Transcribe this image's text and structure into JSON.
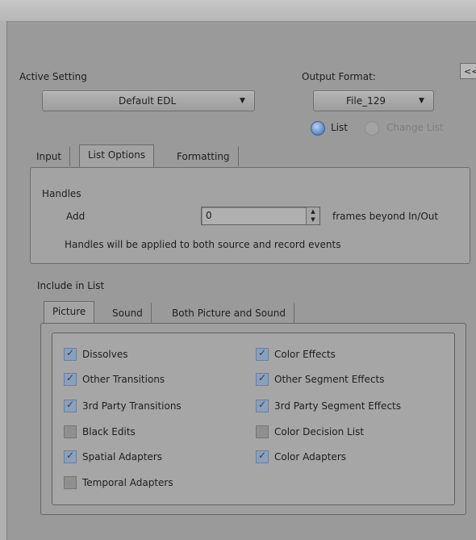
{
  "collapse_button": "<<",
  "active_setting": {
    "label": "Active Setting",
    "value": "Default EDL"
  },
  "output_format": {
    "label": "Output Format:",
    "value": "File_129"
  },
  "list_mode": {
    "list_label": "List",
    "change_list_label": "Change List",
    "selected": "List"
  },
  "main_tabs": {
    "input": "Input",
    "list_options": "List Options",
    "formatting": "Formatting",
    "active": "List Options"
  },
  "handles": {
    "title": "Handles",
    "add_label": "Add",
    "value": "0",
    "suffix": "frames beyond In/Out",
    "note": "Handles will be applied to both source and record events"
  },
  "include": {
    "title": "Include in List",
    "tabs": {
      "picture": "Picture",
      "sound": "Sound",
      "both": "Both Picture and Sound",
      "active": "Picture"
    },
    "left": [
      {
        "label": "Dissolves",
        "checked": true
      },
      {
        "label": "Other Transitions",
        "checked": true
      },
      {
        "label": "3rd Party Transitions",
        "checked": true
      },
      {
        "label": "Black Edits",
        "checked": false
      },
      {
        "label": "Spatial Adapters",
        "checked": true
      },
      {
        "label": "Temporal Adapters",
        "checked": false
      }
    ],
    "right": [
      {
        "label": "Color Effects",
        "checked": true
      },
      {
        "label": "Other Segment Effects",
        "checked": true
      },
      {
        "label": "3rd Party Segment Effects",
        "checked": true
      },
      {
        "label": "Color Decision List",
        "checked": false
      },
      {
        "label": "Color Adapters",
        "checked": true
      }
    ]
  }
}
